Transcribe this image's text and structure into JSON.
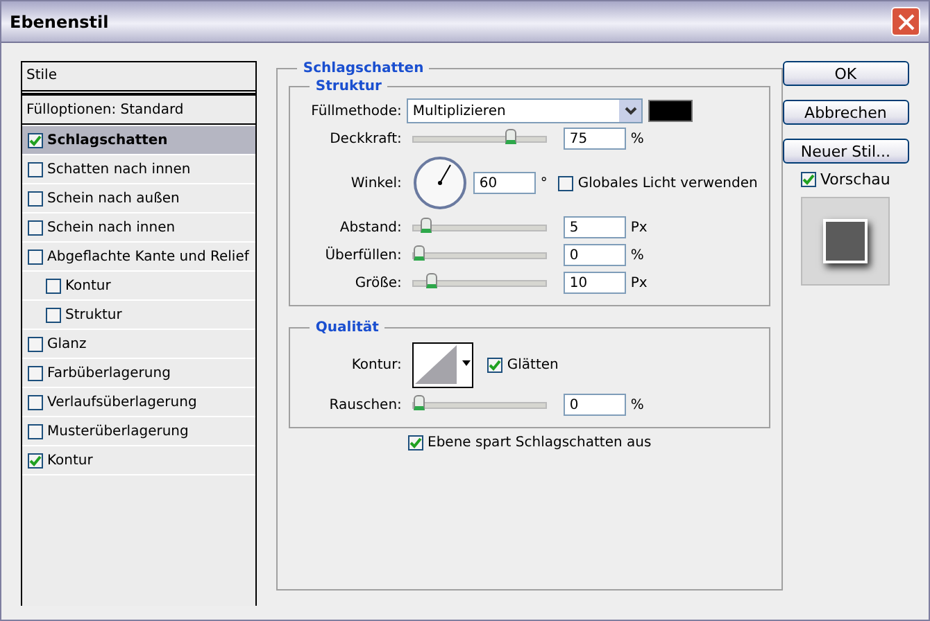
{
  "window": {
    "title": "Ebenenstil"
  },
  "styles_header": "Stile",
  "blend_options": "Fülloptionen: Standard",
  "styles": [
    {
      "label": "Schlagschatten",
      "checked": true,
      "selected": true
    },
    {
      "label": "Schatten nach innen",
      "checked": false,
      "selected": false
    },
    {
      "label": "Schein nach außen",
      "checked": false,
      "selected": false
    },
    {
      "label": "Schein nach innen",
      "checked": false,
      "selected": false
    },
    {
      "label": "Abgeflachte Kante und Relief",
      "checked": false,
      "selected": false,
      "children": [
        {
          "label": "Kontur",
          "checked": false,
          "selected": false
        },
        {
          "label": "Struktur",
          "checked": false,
          "selected": false
        }
      ]
    },
    {
      "label": "Glanz",
      "checked": false,
      "selected": false
    },
    {
      "label": "Farbüberlagerung",
      "checked": false,
      "selected": false
    },
    {
      "label": "Verlaufsüberlagerung",
      "checked": false,
      "selected": false
    },
    {
      "label": "Musterüberlagerung",
      "checked": false,
      "selected": false
    },
    {
      "label": "Kontur",
      "checked": true,
      "selected": false
    }
  ],
  "panel": {
    "title": "Schlagschatten",
    "structure": {
      "title": "Struktur",
      "blend_mode": {
        "label": "Füllmethode:",
        "value": "Multiplizieren",
        "color": "#000000"
      },
      "opacity": {
        "label": "Deckkraft:",
        "level": 0.75,
        "value": "75",
        "unit": "%"
      },
      "angle": {
        "label": "Winkel:",
        "value": "60",
        "unit": "°",
        "global_light": {
          "label": "Globales Licht verwenden",
          "checked": false
        }
      },
      "sliders": [
        {
          "label": "Abstand:",
          "level": 0.05,
          "value": "5",
          "unit": "Px"
        },
        {
          "label": "Überfüllen:",
          "level": 0,
          "value": "0",
          "unit": "%"
        },
        {
          "label": "Größe:",
          "level": 0.1,
          "value": "10",
          "unit": "Px"
        }
      ]
    },
    "quality": {
      "title": "Qualität",
      "contour_label": "Kontur:",
      "antialias": {
        "label": "Glätten",
        "checked": true
      },
      "noise": {
        "label": "Rauschen:",
        "level": 0,
        "value": "0",
        "unit": "%"
      }
    },
    "knockout": {
      "label": "Ebene spart Schlagschatten aus",
      "checked": true
    }
  },
  "buttons": [
    "OK",
    "Abbrechen",
    "Neuer Stil..."
  ],
  "preview": {
    "label": "Vorschau",
    "checked": true
  }
}
